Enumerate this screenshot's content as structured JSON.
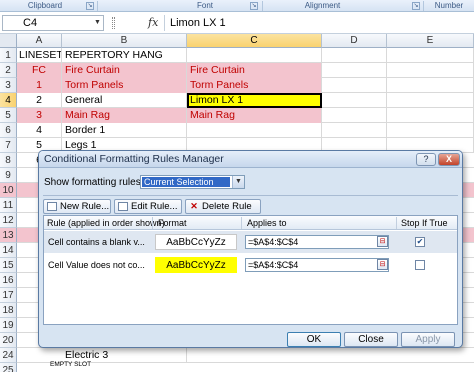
{
  "ribbon": {
    "groups": [
      "Clipboard",
      "Font",
      "Alignment",
      "Number"
    ]
  },
  "formula_bar": {
    "name_box": "C4",
    "fx_label": "fx",
    "formula": "Limon LX 1"
  },
  "sheet": {
    "columns": [
      "A",
      "B",
      "C",
      "D",
      "E"
    ],
    "rows": [
      {
        "num": "1",
        "a": "LINESET #",
        "b": "REPERTORY HANG",
        "c": ""
      },
      {
        "num": "2",
        "a": "FC",
        "b": "Fire Curtain",
        "c": "Fire Curtain"
      },
      {
        "num": "3",
        "a": "1",
        "b": "Torm Panels",
        "c": "Torm Panels"
      },
      {
        "num": "4",
        "a": "2",
        "b": "General",
        "c": "Limon LX 1"
      },
      {
        "num": "5",
        "a": "3",
        "b": "Main Rag",
        "c": "Main Rag"
      },
      {
        "num": "6",
        "a": "4",
        "b": "Border 1",
        "c": ""
      },
      {
        "num": "7",
        "a": "5",
        "b": "Legs 1",
        "c": ""
      },
      {
        "num": "8",
        "a": "6",
        "b": "",
        "c": ""
      }
    ],
    "hidden_row_nums": [
      "9",
      "10",
      "11",
      "12",
      "13",
      "14",
      "15",
      "16",
      "17",
      "18",
      "19",
      "20",
      "21",
      "22",
      "23",
      "24",
      "25"
    ],
    "bottom_rows": [
      {
        "num": "24",
        "b": "Electric 3"
      },
      {
        "num": "25",
        "b": ""
      }
    ],
    "empty_slot_label": "EMPTY SLOT",
    "colors": {
      "pink_fill": "#f3c4ce",
      "red_text": "#c00000",
      "yellow_fill": "#ffff00"
    }
  },
  "dialog": {
    "title": "Conditional Formatting Rules Manager",
    "help_label": "?",
    "close_label": "X",
    "show_label": "Show formatting rules for:",
    "show_value": "Current Selection",
    "buttons": {
      "new_rule": "New Rule...",
      "edit_rule": "Edit Rule...",
      "delete_rule": "Delete Rule"
    },
    "columns": {
      "rule": "Rule (applied in order shown)",
      "format": "Format",
      "applies_to": "Applies to",
      "stop_if_true": "Stop If True"
    },
    "rules": [
      {
        "rule": "Cell contains a blank v...",
        "format_preview": "AaBbCcYyZz",
        "applies_to": "=$A$4:$C$4",
        "stop_if_true": true,
        "preview_bg": "#ffffff"
      },
      {
        "rule": "Cell Value does not co...",
        "format_preview": "AaBbCcYyZz",
        "applies_to": "=$A$4:$C$4",
        "stop_if_true": false,
        "preview_bg": "#ffff00"
      }
    ],
    "footer": {
      "ok": "OK",
      "cancel": "Close",
      "apply": "Apply"
    }
  }
}
